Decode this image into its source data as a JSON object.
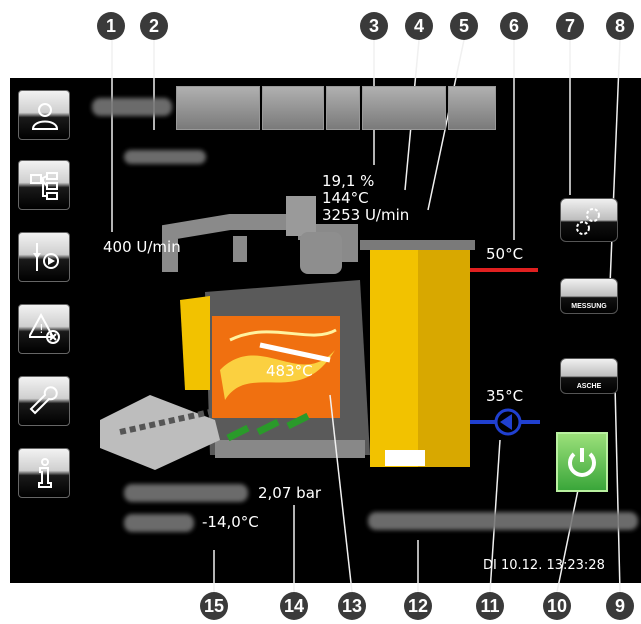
{
  "callouts": [
    "1",
    "2",
    "3",
    "4",
    "5",
    "6",
    "7",
    "8",
    "9",
    "10",
    "11",
    "12",
    "13",
    "14",
    "15"
  ],
  "readings": {
    "fan_speed": "400 U/min",
    "o2": "19,1 %",
    "flue_temp": "144°C",
    "fan2_speed": "3253 U/min",
    "boiler_temp": "50°C",
    "return_temp": "35°C",
    "combustion_temp": "483°C",
    "pressure": "2,07 bar",
    "outside_temp": "-14,0°C"
  },
  "buttons": {
    "measurement": "MESSUNG",
    "ash": "ASCHE"
  },
  "status": {
    "datetime": "DI 10.12. 13:23:28"
  },
  "icons": {
    "side": [
      "user-icon",
      "hierarchy-icon",
      "pump-valve-icon",
      "alarm-reset-icon",
      "wrench-icon",
      "info-icon"
    ],
    "right": [
      "gears-icon",
      "power-icon"
    ]
  },
  "colors": {
    "boiler_yellow": "#f2c200",
    "flow_line": "#e02020",
    "return_line": "#2040d0",
    "power_green": "#3aa63a"
  }
}
